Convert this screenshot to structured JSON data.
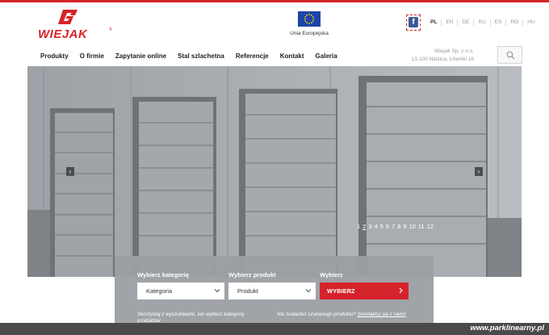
{
  "brand": {
    "name": "WIEJAK",
    "reg": "®",
    "color": "#d5232b"
  },
  "eu": {
    "label": "Unia Europejska"
  },
  "social": {
    "facebook_glyph": "f"
  },
  "languages": [
    "PL",
    "EN",
    "DE",
    "RU",
    "ES",
    "RO",
    "HU"
  ],
  "active_language": "PL",
  "nav": [
    "Produkty",
    "O firmie",
    "Zapytanie online",
    "Stal szlachetna",
    "Referencje",
    "Kontakt",
    "Galeria"
  ],
  "address": {
    "line1": "Wiejak Sp. z o.o.",
    "line2": "13-100 Nidzica, Litwinki 16"
  },
  "hero": {
    "prev_glyph": "‹",
    "next_glyph": "›",
    "slides": [
      "1",
      "2",
      "3",
      "4",
      "5",
      "6",
      "7",
      "8",
      "9",
      "10",
      "11",
      "12"
    ],
    "active_slide": "2"
  },
  "selector": {
    "category_label": "Wybierz kategorię",
    "category_value": "Kategoria",
    "product_label": "Wybierz produkt",
    "product_value": "Produkt",
    "action_label": "Wybierz",
    "action_button": "WYBIERZ",
    "hint_left": "Skorzystaj z wyszukiwarki, lub wybierz kategorię produktów",
    "hint_right_prefix": "Nie znalazłeś szukanego produktu?",
    "hint_right_link": "Skontaktuj się z nami!"
  },
  "watermark": "www.parklinearny.pl"
}
